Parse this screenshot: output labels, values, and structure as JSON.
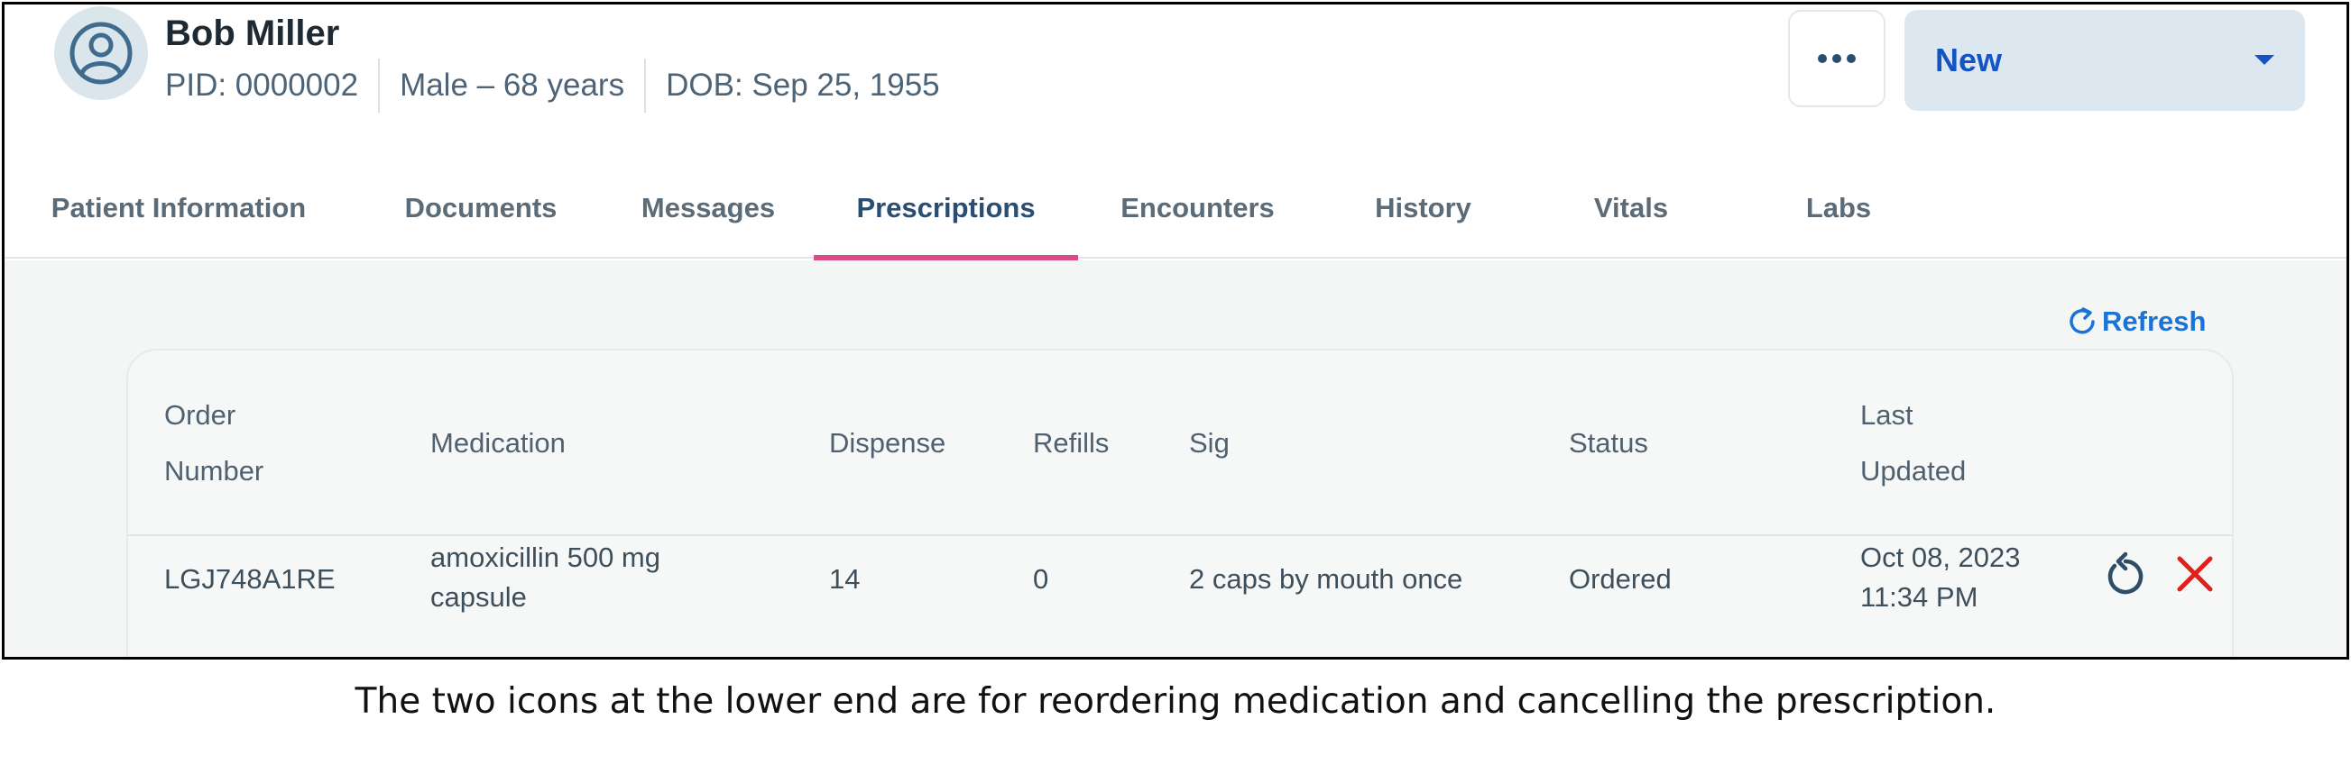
{
  "patient": {
    "name": "Bob Miller",
    "pid": "PID: 0000002",
    "sex_age": "Male – 68 years",
    "dob": "DOB: Sep 25, 1955"
  },
  "header": {
    "more_icon": "more-horizontal-icon",
    "new_button_label": "New",
    "new_dropdown_icon": "caret-down-icon"
  },
  "tabs": [
    {
      "label": "Patient Information",
      "active": false
    },
    {
      "label": "Documents",
      "active": false
    },
    {
      "label": "Messages",
      "active": false
    },
    {
      "label": "Prescriptions",
      "active": true
    },
    {
      "label": "Encounters",
      "active": false
    },
    {
      "label": "History",
      "active": false
    },
    {
      "label": "Vitals",
      "active": false
    },
    {
      "label": "Labs",
      "active": false
    }
  ],
  "refresh": {
    "label": "Refresh",
    "icon": "refresh-icon"
  },
  "table": {
    "headers": {
      "order_number": [
        "Order",
        "Number"
      ],
      "medication": "Medication",
      "dispense": "Dispense",
      "refills": "Refills",
      "sig": "Sig",
      "status": "Status",
      "last_updated": [
        "Last",
        "Updated"
      ]
    },
    "rows": [
      {
        "order_number": "LGJ748A1RE",
        "medication": [
          "amoxicillin 500 mg",
          "capsule"
        ],
        "dispense": "14",
        "refills": "0",
        "sig": "2 caps by mouth once",
        "status": "Ordered",
        "last_updated": [
          "Oct 08, 2023",
          "11:34 PM"
        ],
        "actions": [
          "reorder-icon",
          "cancel-icon"
        ]
      }
    ]
  },
  "colors": {
    "accent_blue": "#1a73d6",
    "tab_indicator": "#d94a86",
    "cancel_red": "#e0201b"
  },
  "caption": "The two icons at the lower end are for reordering medication and cancelling the prescription."
}
